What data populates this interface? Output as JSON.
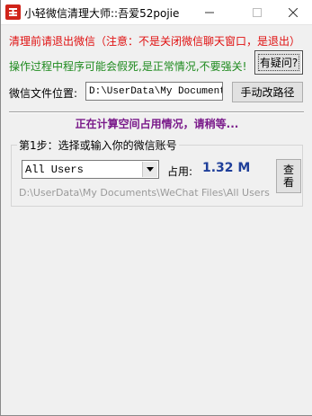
{
  "window": {
    "title": "小轻微信清理大师::吾爱52pojie"
  },
  "warnings": {
    "exit_notice": "清理前请退出微信（注意：不是关闭微信聊天窗口，是退出）",
    "freeze_notice": "操作过程中程序可能会假死,是正常情况,不要强关!"
  },
  "buttons": {
    "question": "有疑问?",
    "change_path": "手动改路径",
    "view_line1": "查",
    "view_line2": "看"
  },
  "path": {
    "label": "微信文件位置:",
    "value": "D:\\UserData\\My Documents"
  },
  "status": {
    "calculating": "正在计算空间占用情况，请稍等..."
  },
  "step1": {
    "legend": "第1步：选择或输入你的微信账号",
    "account_selected": "All Users",
    "usage_label": "占用:",
    "usage_value": "1.32 M",
    "full_path": "D:\\UserData\\My Documents\\WeChat Files\\All Users"
  },
  "icons": {
    "app": "wechat-cleaner-app-icon",
    "minimize": "minimize-icon",
    "maximize": "maximize-icon",
    "close": "close-icon",
    "dropdown": "chevron-down-icon"
  },
  "colors": {
    "warning_red": "#e01010",
    "warning_green": "#1e8a1e",
    "status_purple": "#7a1a8a",
    "usage_blue": "#1f3f9a"
  }
}
